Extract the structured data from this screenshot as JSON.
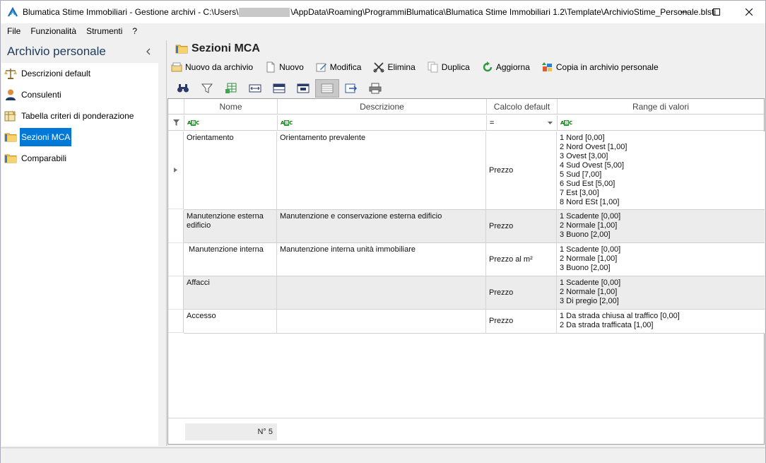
{
  "window": {
    "title_pre": "Blumatica Stime Immobiliari - Gestione archivi - C:\\Users\\",
    "title_post": "\\AppData\\Roaming\\ProgrammiBlumatica\\Blumatica Stime Immobiliari 1.2\\Template\\ArchivioStime_Personale.blsti",
    "controls": [
      "minimize-icon",
      "maximize-icon",
      "close-icon"
    ]
  },
  "menu": {
    "items": [
      "File",
      "Funzionalità",
      "Strumenti",
      "?"
    ]
  },
  "sidebar": {
    "title": "Archivio personale",
    "collapse_icon": "chevron-left-icon",
    "items": [
      {
        "label": "Descrizioni default",
        "icon": "scales-icon"
      },
      {
        "label": "Consulenti",
        "icon": "person-icon"
      },
      {
        "label": "Tabella criteri di ponderazione",
        "icon": "table-scales-icon"
      },
      {
        "label": "Sezioni MCA",
        "icon": "folder-icon",
        "selected": true
      },
      {
        "label": "Comparabili",
        "icon": "folder-icon"
      }
    ],
    "selected_color": "#0078d7"
  },
  "panel": {
    "title": "Sezioni MCA",
    "toolbar": {
      "nuovo_da_archivio": "Nuovo da archivio",
      "nuovo": "Nuovo",
      "modifica": "Modifica",
      "elimina": "Elimina",
      "duplica": "Duplica",
      "aggiorna": "Aggiorna",
      "copia": "Copia in archivio personale"
    },
    "toolbar2_icons": [
      "binoculars-icon",
      "filter-icon",
      "grid-add-icon",
      "fit-width-icon",
      "columns-icon",
      "group-icon",
      "gridlines-icon",
      "export-icon",
      "print-icon"
    ]
  },
  "grid": {
    "columns": [
      "Nome",
      "Descrizione",
      "Calcolo default",
      "Range di valori"
    ],
    "filter_operator": "=",
    "rows": [
      {
        "nome": "Orientamento",
        "descrizione": "Orientamento prevalente",
        "calcolo": "Prezzo",
        "range": [
          "1 Nord [0,00]",
          "2 Nord Ovest [1,00]",
          "3 Ovest [3,00]",
          "4 Sud Ovest [5,00]",
          "5 Sud [7,00]",
          "6 Sud Est [5,00]",
          "7 Est [3,00]",
          "8 Nord ESt [1,00]"
        ]
      },
      {
        "nome": "Manutenzione esterna edificio",
        "descrizione": "Manutenzione e conservazione esterna edificio",
        "calcolo": "Prezzo",
        "range": [
          "1 Scadente [0,00]",
          "2 Normale [1,00]",
          "3 Buono [2,00]"
        ]
      },
      {
        "nome": " Manutenzione interna",
        "descrizione": "Manutenzione interna unità immobiliare",
        "calcolo": "Prezzo al m²",
        "range": [
          "1 Scadente [0,00]",
          "2 Normale [1,00]",
          "3 Buono [2,00]"
        ]
      },
      {
        "nome": "Affacci",
        "descrizione": "",
        "calcolo": "Prezzo",
        "range": [
          "1 Scadente [0,00]",
          "2 Normale [1,00]",
          "3 Di pregio [2,00]"
        ]
      },
      {
        "nome": "Accesso",
        "descrizione": "",
        "calcolo": "Prezzo",
        "range": [
          "1 Da strada chiusa al traffico [0,00]",
          "2 Da strada trafficata [1,00]"
        ]
      }
    ],
    "footer_count": "N° 5",
    "alt_row_color": "#ececec"
  }
}
